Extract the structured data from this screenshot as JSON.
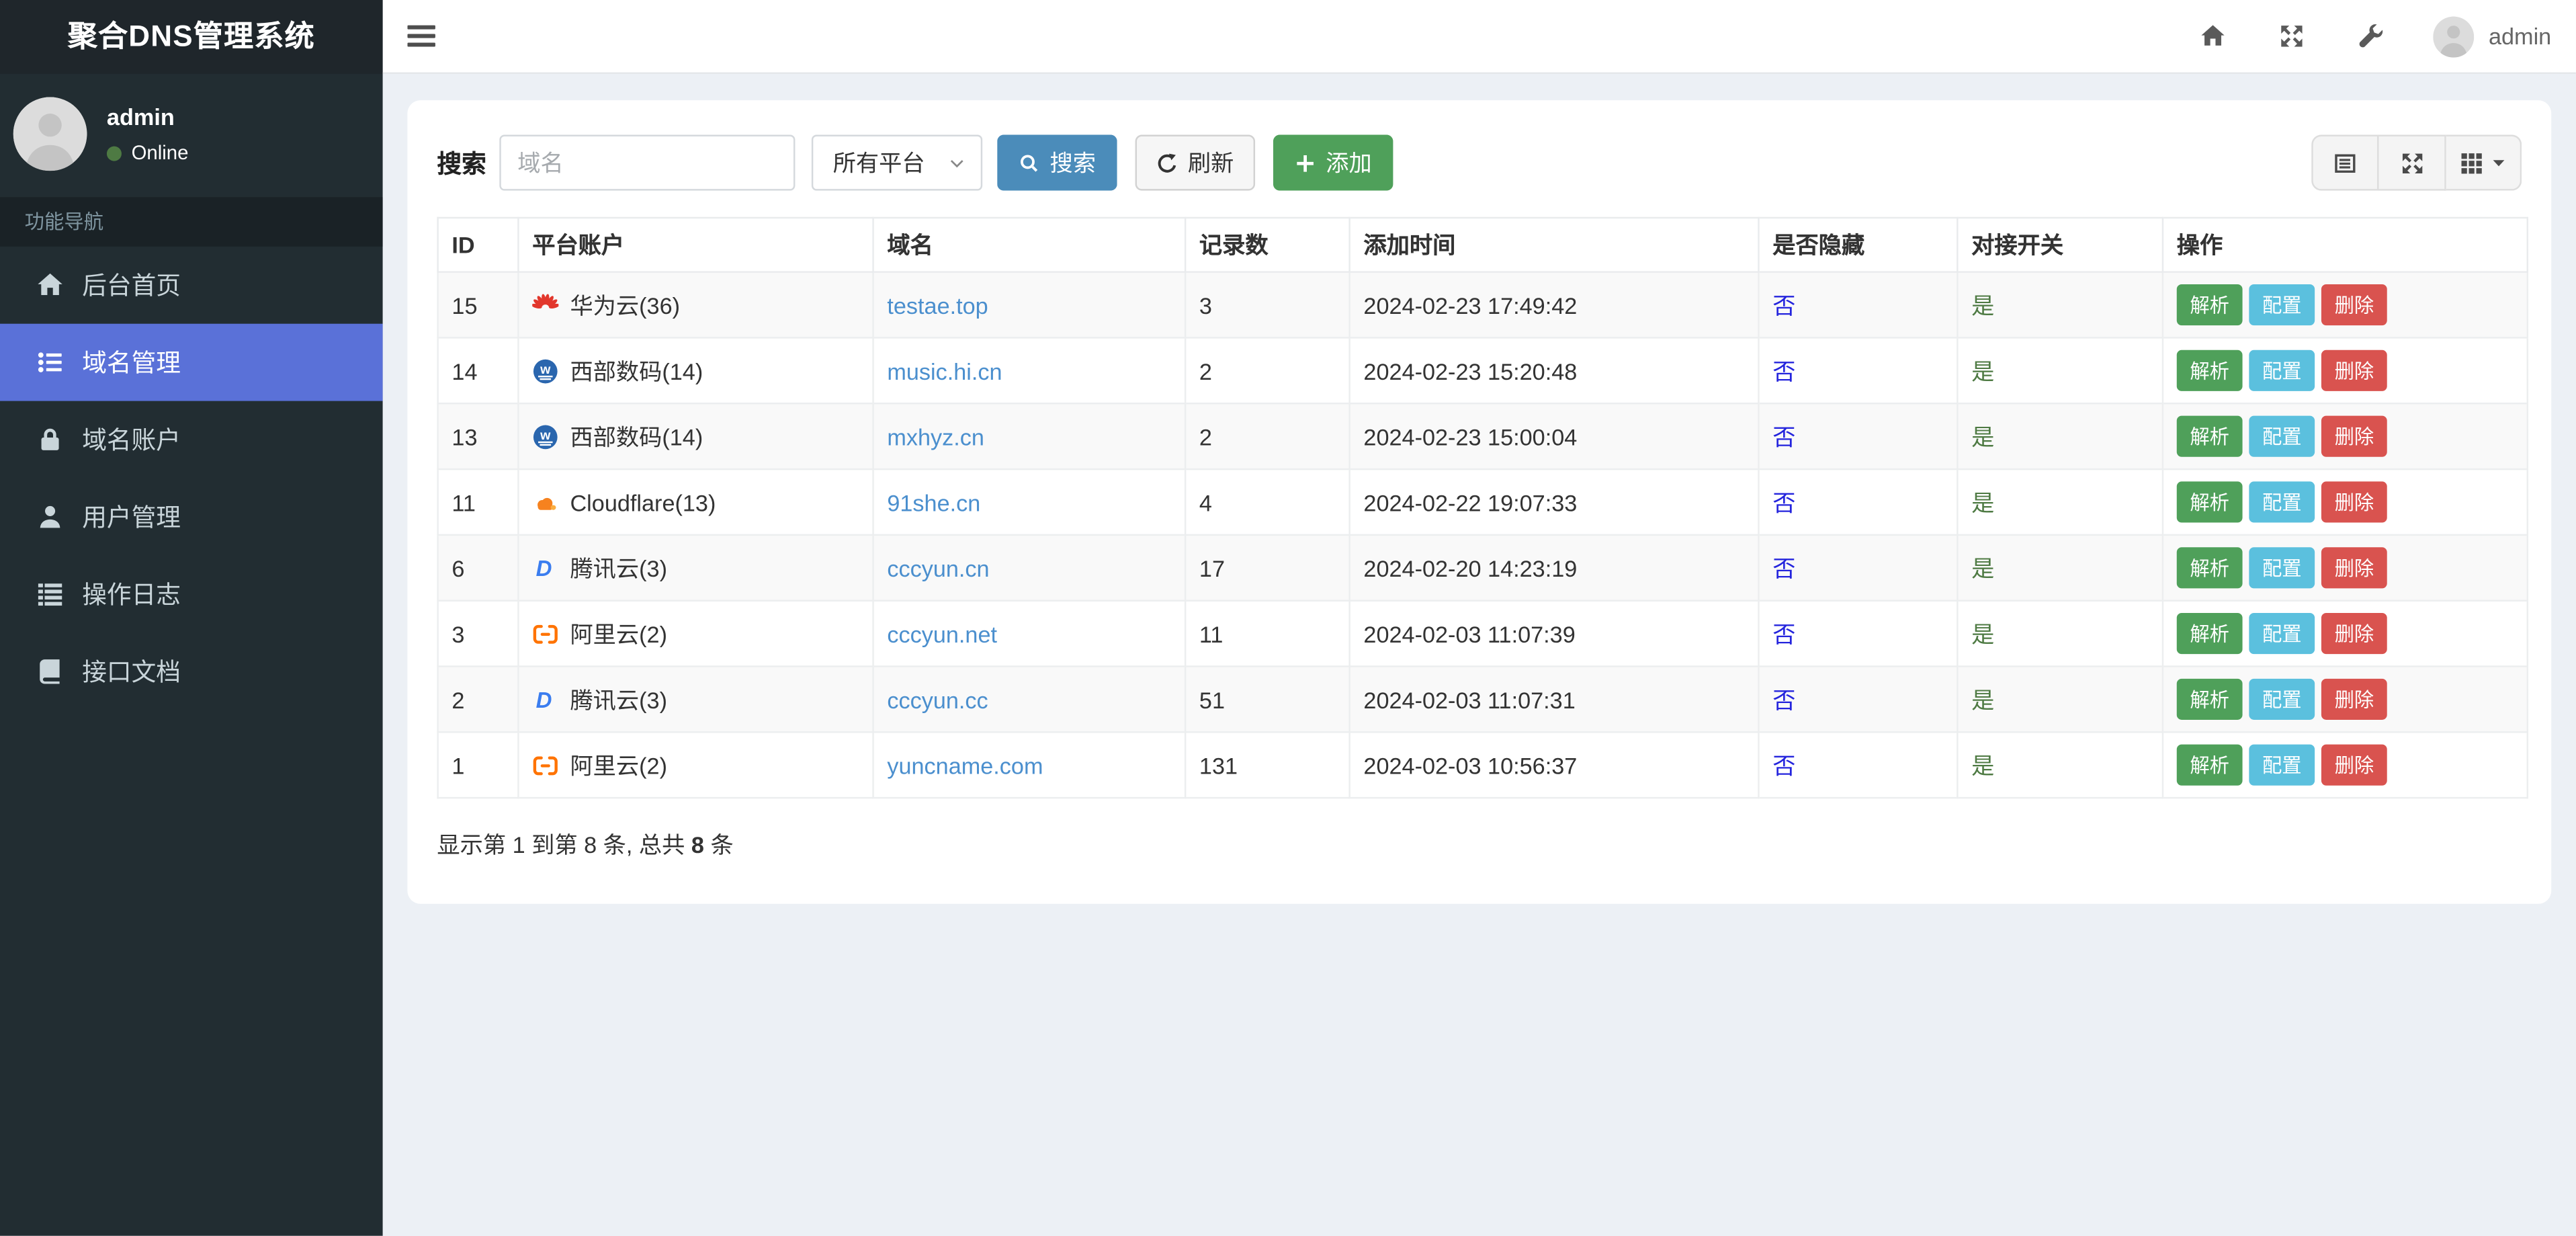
{
  "app": {
    "title": "聚合DNS管理系统"
  },
  "topbar": {
    "username": "admin",
    "icons": [
      "menu-icon",
      "home-icon",
      "fullscreen-icon",
      "wrench-icon",
      "avatar-icon"
    ]
  },
  "sidebar": {
    "user": {
      "name": "admin",
      "status": "Online"
    },
    "section_label": "功能导航",
    "items": [
      {
        "label": "后台首页",
        "icon": "home-icon",
        "active": false
      },
      {
        "label": "域名管理",
        "icon": "list-icon",
        "active": true
      },
      {
        "label": "域名账户",
        "icon": "lock-icon",
        "active": false
      },
      {
        "label": "用户管理",
        "icon": "user-icon",
        "active": false
      },
      {
        "label": "操作日志",
        "icon": "log-list-icon",
        "active": false
      },
      {
        "label": "接口文档",
        "icon": "book-icon",
        "active": false
      }
    ]
  },
  "toolbar": {
    "search_label": "搜索",
    "domain_placeholder": "域名",
    "domain_value": "",
    "platform_select": "所有平台",
    "search_button": "搜索",
    "refresh_button": "刷新",
    "add_button": "添加",
    "view_buttons": [
      "table-view-icon",
      "expand-icon",
      "grid-icon"
    ]
  },
  "table": {
    "columns": [
      "ID",
      "平台账户",
      "域名",
      "记录数",
      "添加时间",
      "是否隐藏",
      "对接开关",
      "操作"
    ],
    "actions": [
      "解析",
      "配置",
      "删除"
    ],
    "rows": [
      {
        "id": "15",
        "platform": "华为云(36)",
        "platform_icon": "huawei-cloud-icon",
        "domain": "testae.top",
        "records": "3",
        "added": "2024-02-23 17:49:42",
        "hidden": "否",
        "switch": "是"
      },
      {
        "id": "14",
        "platform": "西部数码(14)",
        "platform_icon": "west-digital-icon",
        "domain": "music.hi.cn",
        "records": "2",
        "added": "2024-02-23 15:20:48",
        "hidden": "否",
        "switch": "是"
      },
      {
        "id": "13",
        "platform": "西部数码(14)",
        "platform_icon": "west-digital-icon",
        "domain": "mxhyz.cn",
        "records": "2",
        "added": "2024-02-23 15:00:04",
        "hidden": "否",
        "switch": "是"
      },
      {
        "id": "11",
        "platform": "Cloudflare(13)",
        "platform_icon": "cloudflare-icon",
        "domain": "91she.cn",
        "records": "4",
        "added": "2024-02-22 19:07:33",
        "hidden": "否",
        "switch": "是"
      },
      {
        "id": "6",
        "platform": "腾讯云(3)",
        "platform_icon": "dnspod-icon",
        "domain": "cccyun.cn",
        "records": "17",
        "added": "2024-02-20 14:23:19",
        "hidden": "否",
        "switch": "是"
      },
      {
        "id": "3",
        "platform": "阿里云(2)",
        "platform_icon": "aliyun-icon",
        "domain": "cccyun.net",
        "records": "11",
        "added": "2024-02-03 11:07:39",
        "hidden": "否",
        "switch": "是"
      },
      {
        "id": "2",
        "platform": "腾讯云(3)",
        "platform_icon": "dnspod-icon",
        "domain": "cccyun.cc",
        "records": "51",
        "added": "2024-02-03 11:07:31",
        "hidden": "否",
        "switch": "是"
      },
      {
        "id": "1",
        "platform": "阿里云(2)",
        "platform_icon": "aliyun-icon",
        "domain": "yuncname.com",
        "records": "131",
        "added": "2024-02-03 10:56:37",
        "hidden": "否",
        "switch": "是"
      }
    ],
    "summary_prefix": "显示第 1 到第 8 条, 总共 ",
    "summary_total": "8",
    "summary_suffix": " 条"
  },
  "colors": {
    "sidebar_active": "#5a71d8",
    "btn_primary": "#4b8cba",
    "btn_success": "#4fa05a",
    "btn_info": "#5bc0de",
    "btn_danger": "#d9534f",
    "link_domain": "#4b8fce",
    "link_blue": "#2424dd",
    "green_text": "#4e7a43",
    "content_bg": "#ecf0f5",
    "sidebar_bg": "#222d32",
    "logo_bg": "#1f262b"
  }
}
